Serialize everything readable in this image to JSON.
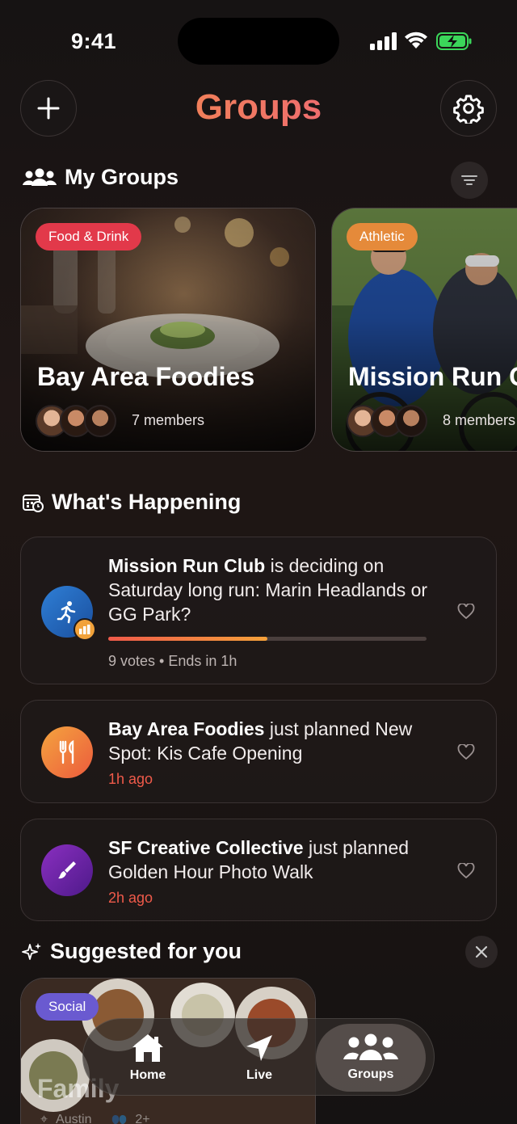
{
  "status_bar": {
    "time": "9:41"
  },
  "header": {
    "title": "Groups"
  },
  "my_groups": {
    "heading": "My Groups",
    "cards": [
      {
        "category": "Food & Drink",
        "category_color": "#e2394a",
        "name": "Bay Area Foodies",
        "members": "7 members"
      },
      {
        "category": "Athletic",
        "category_color": "#e58a3a",
        "name": "Mission Run Club",
        "members": "8 members"
      }
    ]
  },
  "whats_happening": {
    "heading": "What's Happening",
    "items": [
      {
        "group": "Mission Run Club",
        "text": " is deciding on Saturday long run: Marin Headlands or GG Park?",
        "meta": "9 votes • Ends in 1h",
        "icon": "runner-icon",
        "progress": 0.5
      },
      {
        "group": "Bay Area Foodies",
        "text": " just planned New Spot: Kis Cafe Opening",
        "meta": "1h ago",
        "icon": "utensils-icon"
      },
      {
        "group": "SF Creative Collective",
        "text": " just planned Golden Hour Photo Walk",
        "meta": "2h ago",
        "icon": "brush-icon"
      }
    ]
  },
  "suggested": {
    "heading": "Suggested for you",
    "card": {
      "category": "Social",
      "name": "Family",
      "location": "Austin",
      "count": "2+"
    }
  },
  "tabbar": {
    "tabs": [
      {
        "label": "Home",
        "icon": "home-icon"
      },
      {
        "label": "Live",
        "icon": "navigation-arrow-icon"
      },
      {
        "label": "Groups",
        "icon": "people-icon",
        "active": true
      }
    ]
  },
  "colors": {
    "accent_orange": "#f59b3c",
    "accent_pink": "#e2477e",
    "meta_red": "#ef5a4a"
  }
}
